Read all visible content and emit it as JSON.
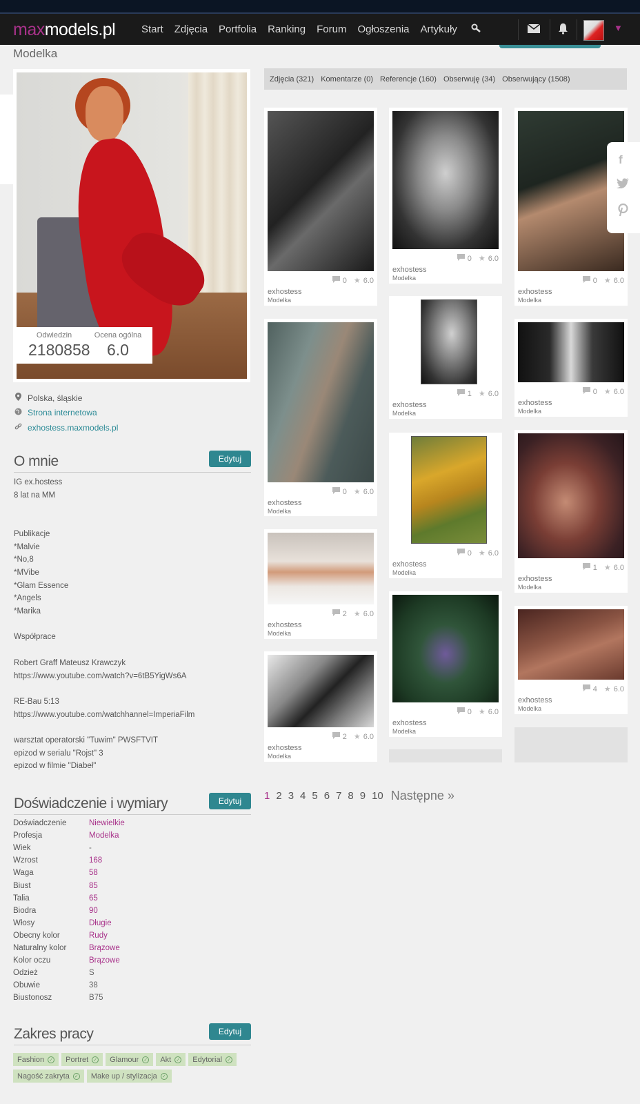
{
  "nav": {
    "logo_max": "max",
    "logo_rest": "models.pl",
    "links": [
      "Start",
      "Zdjęcia",
      "Portfolia",
      "Ranking",
      "Forum",
      "Ogłoszenia",
      "Artykuły"
    ]
  },
  "profile": {
    "type": "Modelka",
    "visits_label": "Odwiedzin",
    "visits": "2180858",
    "rating_label": "Ocena ogólna",
    "rating": "6.0",
    "location": "Polska, śląskie",
    "website": "Strona internetowa",
    "profile_url": "exhostess.maxmodels.pl"
  },
  "about": {
    "title": "O mnie",
    "edit": "Edytuj",
    "text": "IG ex.hostess\n8 lat na MM\n\n\nPublikacje\n*Malvie\n*No,8\n*MVibe\n*Glam Essence\n*Angels\n*Marika\n\nWspółprace\n\nRobert Graff Mateusz Krawczyk\nhttps://www.youtube.com/watch?v=6tB5YigWs6A\n\nRE-Bau 5:13\nhttps://www.youtube.com/watchhannel=ImperiaFilm\n\nwarsztat operatorski \"Tuwim\" PWSFTVIT\nepizod w serialu \"Rojst\" 3\nepizod w filmie \"Diabeł\""
  },
  "experience": {
    "title": "Doświadczenie i wymiary",
    "edit": "Edytuj",
    "rows": [
      {
        "k": "Doświadczenie",
        "v": "Niewielkie"
      },
      {
        "k": "Profesja",
        "v": "Modelka"
      },
      {
        "k": "Wiek",
        "v": "-"
      },
      {
        "k": "Wzrost",
        "v": "168"
      },
      {
        "k": "Waga",
        "v": "58"
      },
      {
        "k": "Biust",
        "v": "85"
      },
      {
        "k": "Talia",
        "v": "65"
      },
      {
        "k": "Biodra",
        "v": "90"
      },
      {
        "k": "Włosy",
        "v": "Długie"
      },
      {
        "k": "Obecny kolor",
        "v": "Rudy"
      },
      {
        "k": "Naturalny kolor",
        "v": "Brązowe"
      },
      {
        "k": "Kolor oczu",
        "v": "Brązowe"
      },
      {
        "k": "Odzież",
        "v": "S"
      },
      {
        "k": "Obuwie",
        "v": "38"
      },
      {
        "k": "Biustonosz",
        "v": "B75"
      }
    ]
  },
  "work": {
    "title": "Zakres pracy",
    "edit": "Edytuj",
    "tags": [
      "Fashion",
      "Portret",
      "Glamour",
      "Akt",
      "Edytorial",
      "Nagość zakryta",
      "Make up / stylizacja"
    ]
  },
  "tabs": [
    "Zdjęcia (321)",
    "Komentarze (0)",
    "Referencje (160)",
    "Obserwuję (34)",
    "Obserwujący (1508)"
  ],
  "photos": [
    {
      "comments": "0",
      "rating": "6.0",
      "author": "exhostess",
      "role": "Modelka"
    },
    {
      "comments": "0",
      "rating": "6.0",
      "author": "exhostess",
      "role": "Modelka"
    },
    {
      "comments": "0",
      "rating": "6.0",
      "author": "exhostess",
      "role": "Modelka"
    },
    {
      "comments": "0",
      "rating": "6.0",
      "author": "exhostess",
      "role": "Modelka"
    },
    {
      "comments": "1",
      "rating": "6.0",
      "author": "exhostess",
      "role": "Modelka"
    },
    {
      "comments": "0",
      "rating": "6.0",
      "author": "exhostess",
      "role": "Modelka"
    },
    {
      "comments": "2",
      "rating": "6.0",
      "author": "exhostess",
      "role": "Modelka"
    },
    {
      "comments": "0",
      "rating": "6.0",
      "author": "exhostess",
      "role": "Modelka"
    },
    {
      "comments": "1",
      "rating": "6.0",
      "author": "exhostess",
      "role": "Modelka"
    },
    {
      "comments": "2",
      "rating": "6.0",
      "author": "exhostess",
      "role": "Modelka"
    },
    {
      "comments": "0",
      "rating": "6.0",
      "author": "exhostess",
      "role": "Modelka"
    },
    {
      "comments": "4",
      "rating": "6.0",
      "author": "exhostess",
      "role": "Modelka"
    }
  ],
  "pagination": {
    "pages": [
      "1",
      "2",
      "3",
      "4",
      "5",
      "6",
      "7",
      "8",
      "9",
      "10"
    ],
    "next": "Następne »"
  },
  "icons": {
    "search": "search-icon",
    "mail": "mail-icon",
    "bell": "bell-icon",
    "location": "location-pin-icon",
    "globe": "globe-icon",
    "link": "link-icon",
    "comment": "comment-icon",
    "star": "star-icon",
    "facebook": "facebook-icon",
    "twitter": "twitter-icon",
    "pinterest": "pinterest-icon"
  },
  "colors": {
    "brand": "#a8328a",
    "accent": "#2f8790",
    "tag_bg": "#cfe2c0"
  }
}
